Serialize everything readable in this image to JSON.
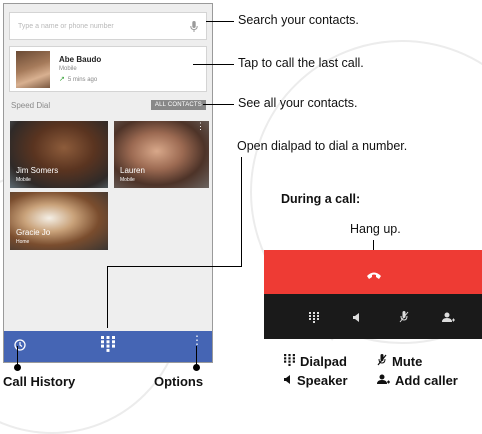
{
  "phone": {
    "search_placeholder": "Type a name or phone number",
    "recent": {
      "name": "Abe Baudo",
      "type": "Mobile",
      "time": "5 mins ago"
    },
    "speed_dial_label": "Speed Dial",
    "all_contacts_label": "ALL CONTACTS",
    "tiles": [
      {
        "name": "Jim Somers",
        "type": "Mobile"
      },
      {
        "name": "Lauren",
        "type": "Mobile"
      },
      {
        "name": "Gracie Jo",
        "type": "Home"
      }
    ],
    "nav_color": "#4565b4"
  },
  "callouts": {
    "search": "Search your contacts.",
    "last_call": "Tap to call the last call.",
    "all_contacts": "See all your contacts.",
    "dialpad": "Open dialpad to dial a number."
  },
  "bottom_labels": {
    "call_history": "Call History",
    "options": "Options"
  },
  "during_call": {
    "title": "During a call:",
    "hang_up": "Hang up.",
    "legend": {
      "dialpad": "Dialpad",
      "mute": "Mute",
      "speaker": "Speaker",
      "add_caller": "Add caller"
    },
    "colors": {
      "hangup_bg": "#ee3b34",
      "bar_bg": "#1a1a1a"
    }
  },
  "icons": [
    "mic-icon",
    "missed-call-arrow-icon",
    "clock-icon",
    "dialpad-icon",
    "more-options-icon",
    "hang-up-icon",
    "speaker-icon",
    "mute-icon",
    "add-caller-icon"
  ]
}
